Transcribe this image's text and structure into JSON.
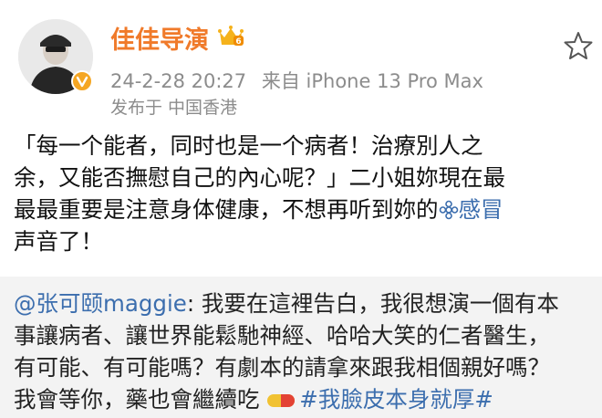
{
  "user": {
    "name": "佳佳导演",
    "verified_badge": "orange-v-icon",
    "member_badge": "crown-vip-icon"
  },
  "post_meta": {
    "timestamp": "24-2-28 20:27",
    "source": "来自 iPhone 13 Pro Max",
    "location": "发布于 中国香港"
  },
  "post": {
    "line1": "「每一个能者，同时也是一个病者！治療別人之",
    "line2": "余，又能否撫慰自己的內心呢？」二小姐妳現在最",
    "line3_before_link": "最最重要是注意身体健康，不想再听到妳的",
    "topic_link": "感冒",
    "line4": "声音了！"
  },
  "repost": {
    "mention": "@张可颐maggie",
    "line1_rest": ": 我要在這裡告白，我很想演一個有本",
    "line2": "事讓病者、讓世界能鬆馳神經、哈哈大笑的仁者醫生，",
    "line3": "有可能、有可能嗎？有劇本的請拿來跟我相個親好嗎？",
    "line4_before": "我會等你，藥也會繼續吃",
    "hashtag": "#我臉皮本身就厚#"
  },
  "colors": {
    "username": "#f07a2a",
    "link": "#3c6eae",
    "meta": "#8c8c8c",
    "repost_bg": "#f3f3f3"
  }
}
